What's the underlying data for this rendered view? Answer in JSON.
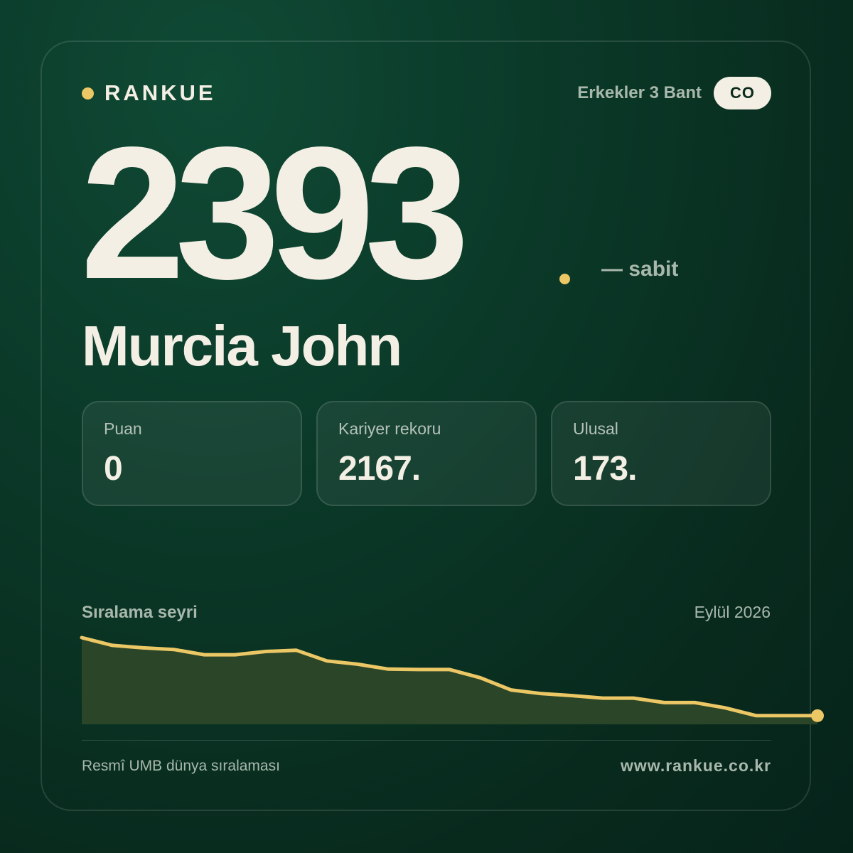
{
  "header": {
    "brand": "RANKUE",
    "division": "Erkekler 3 Bant",
    "country_code": "CO"
  },
  "hero": {
    "rank": "2393",
    "trend": "— sabit",
    "player_name": "Murcia John"
  },
  "stats": [
    {
      "label": "Puan",
      "value": "0"
    },
    {
      "label": "Kariyer rekoru",
      "value": "2167."
    },
    {
      "label": "Ulusal",
      "value": "173."
    }
  ],
  "chart": {
    "title": "Sıralama seyri",
    "period": "Eylül 2026"
  },
  "chart_data": {
    "type": "area",
    "title": "Sıralama seyri",
    "xlabel": "",
    "ylabel": "",
    "grid": false,
    "y_inverted": true,
    "values": [
      0,
      0.095,
      0.125,
      0.145,
      0.21,
      0.21,
      0.17,
      0.155,
      0.285,
      0.325,
      0.385,
      0.39,
      0.39,
      0.49,
      0.64,
      0.685,
      0.71,
      0.74,
      0.74,
      0.795,
      0.795,
      0.86,
      0.955,
      0.955,
      0.955
    ],
    "value_unit": "relative rank position, 0 = earliest point, 1 = latest point (latest rank 2393)",
    "line_color": "#ecc765",
    "fill_color": "#2b4528"
  },
  "footer": {
    "source": "Resmî UMB dünya sıralaması",
    "url": "www.rankue.co.kr"
  },
  "colors": {
    "accent": "#ecc765",
    "text": "#f4efe4",
    "muted": "#a8b8ac",
    "background": "#0b3a29"
  }
}
